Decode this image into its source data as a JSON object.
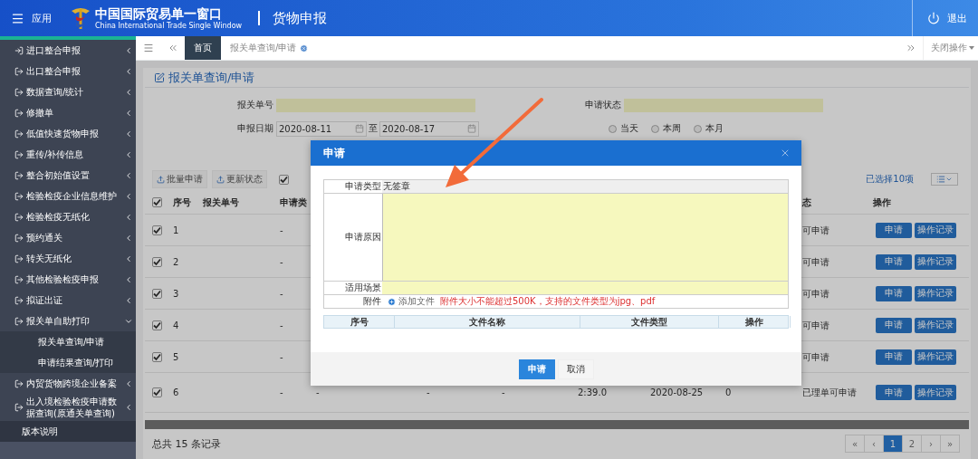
{
  "header": {
    "menu_label": "应用",
    "title": "中国国际贸易单一窗口",
    "subtitle": "China International Trade Single Window",
    "module": "货物申报",
    "logout": "退出"
  },
  "sidebar": {
    "items": [
      {
        "label": "进口整合申报",
        "expanded": false
      },
      {
        "label": "出口整合申报",
        "expanded": false
      },
      {
        "label": "数据查询/统计",
        "expanded": false
      },
      {
        "label": "修撤单",
        "expanded": false
      },
      {
        "label": "低值快速货物申报",
        "expanded": false
      },
      {
        "label": "重传/补传信息",
        "expanded": false
      },
      {
        "label": "整合初始值设置",
        "expanded": false
      },
      {
        "label": "检验检疫企业信息维护",
        "expanded": false
      },
      {
        "label": "检验检疫无纸化",
        "expanded": false
      },
      {
        "label": "预约通关",
        "expanded": false
      },
      {
        "label": "转关无纸化",
        "expanded": false
      },
      {
        "label": "其他检验检疫申报",
        "expanded": false
      },
      {
        "label": "拟证出证",
        "expanded": false
      },
      {
        "label": "报关单自助打印",
        "expanded": true,
        "children": [
          {
            "label": "报关单查询/申请"
          },
          {
            "label": "申请结果查询/打印"
          }
        ]
      },
      {
        "label": "内贸货物跨境企业备案",
        "expanded": false
      },
      {
        "label": "出入境检验检疫申请数据查询(原通关单查询)",
        "expanded": false
      }
    ],
    "footer": "版本说明"
  },
  "tabs": [
    {
      "label": "首页",
      "selected": true,
      "closable": false
    },
    {
      "label": "报关单查询/申请",
      "selected": false,
      "closable": true
    }
  ],
  "tab_menu": "关闭操作",
  "panel": {
    "title": "报关单查询/申请",
    "fields": [
      {
        "label": "报关单号"
      },
      {
        "label": "申请状态"
      }
    ],
    "date_range": {
      "label": "申报日期",
      "from": "2020-08-11",
      "separator": "至",
      "to": "2020-08-17"
    },
    "radios": [
      {
        "label": "当天",
        "selected": false
      },
      {
        "label": "本周",
        "selected": false
      },
      {
        "label": "本月",
        "selected": false
      }
    ],
    "toolbar": {
      "buttons": [
        "批量申请",
        "更新状态"
      ],
      "checked": true,
      "selection": "已选择10项"
    },
    "table": {
      "all_checked": true,
      "columns": [
        "序号",
        "报关单号",
        "申请类"
      ],
      "status_header": "态",
      "actions_header": "操作",
      "rows": [
        {
          "checked": true,
          "index": "1",
          "type": "-",
          "status": "可申请",
          "actions": [
            "申请",
            "操作记录"
          ]
        },
        {
          "checked": true,
          "index": "2",
          "type": "-",
          "status": "可申请",
          "actions": [
            "申请",
            "操作记录"
          ]
        },
        {
          "checked": true,
          "index": "3",
          "type": "-",
          "status": "可申请",
          "actions": [
            "申请",
            "操作记录"
          ]
        },
        {
          "checked": true,
          "index": "4",
          "type": "-",
          "status": "可申请",
          "actions": [
            "申请",
            "操作记录"
          ]
        },
        {
          "checked": true,
          "index": "5",
          "type": "-",
          "status": "可申请",
          "actions": [
            "申请",
            "操作记录"
          ]
        },
        {
          "checked": true,
          "index": "6",
          "type": "-",
          "column_5": "-",
          "column_6": "-",
          "column_7": "-",
          "column_8": "2:39.0",
          "column_9": "2020-08-25",
          "column_10": "0",
          "status": "已理单可申请",
          "actions": [
            "申请",
            "操作记录"
          ]
        }
      ]
    },
    "total": "总共 15 条记录",
    "pagination": [
      {
        "label": "«",
        "selected": false
      },
      {
        "label": "‹",
        "selected": false
      },
      {
        "label": "1",
        "selected": true
      },
      {
        "label": "2",
        "selected": false
      },
      {
        "label": "›",
        "selected": false
      },
      {
        "label": "»",
        "selected": false
      }
    ]
  },
  "modal": {
    "title": "申请",
    "form": [
      {
        "kind": "readonly",
        "label": "申请类型",
        "value": "无签章"
      },
      {
        "kind": "textarea",
        "label": "申请原因"
      },
      {
        "kind": "input",
        "label": "适用场景"
      },
      {
        "kind": "attachment",
        "label": "附件",
        "button": "添加文件",
        "note": "附件大小不能超过500K，支持的文件类型为jpg、pdf"
      }
    ],
    "file_columns": [
      "序号",
      "文件名称",
      "文件类型",
      "操作"
    ],
    "buttons": [
      {
        "label": "申请",
        "kind": "primary"
      },
      {
        "label": "取消",
        "kind": "default"
      }
    ]
  }
}
